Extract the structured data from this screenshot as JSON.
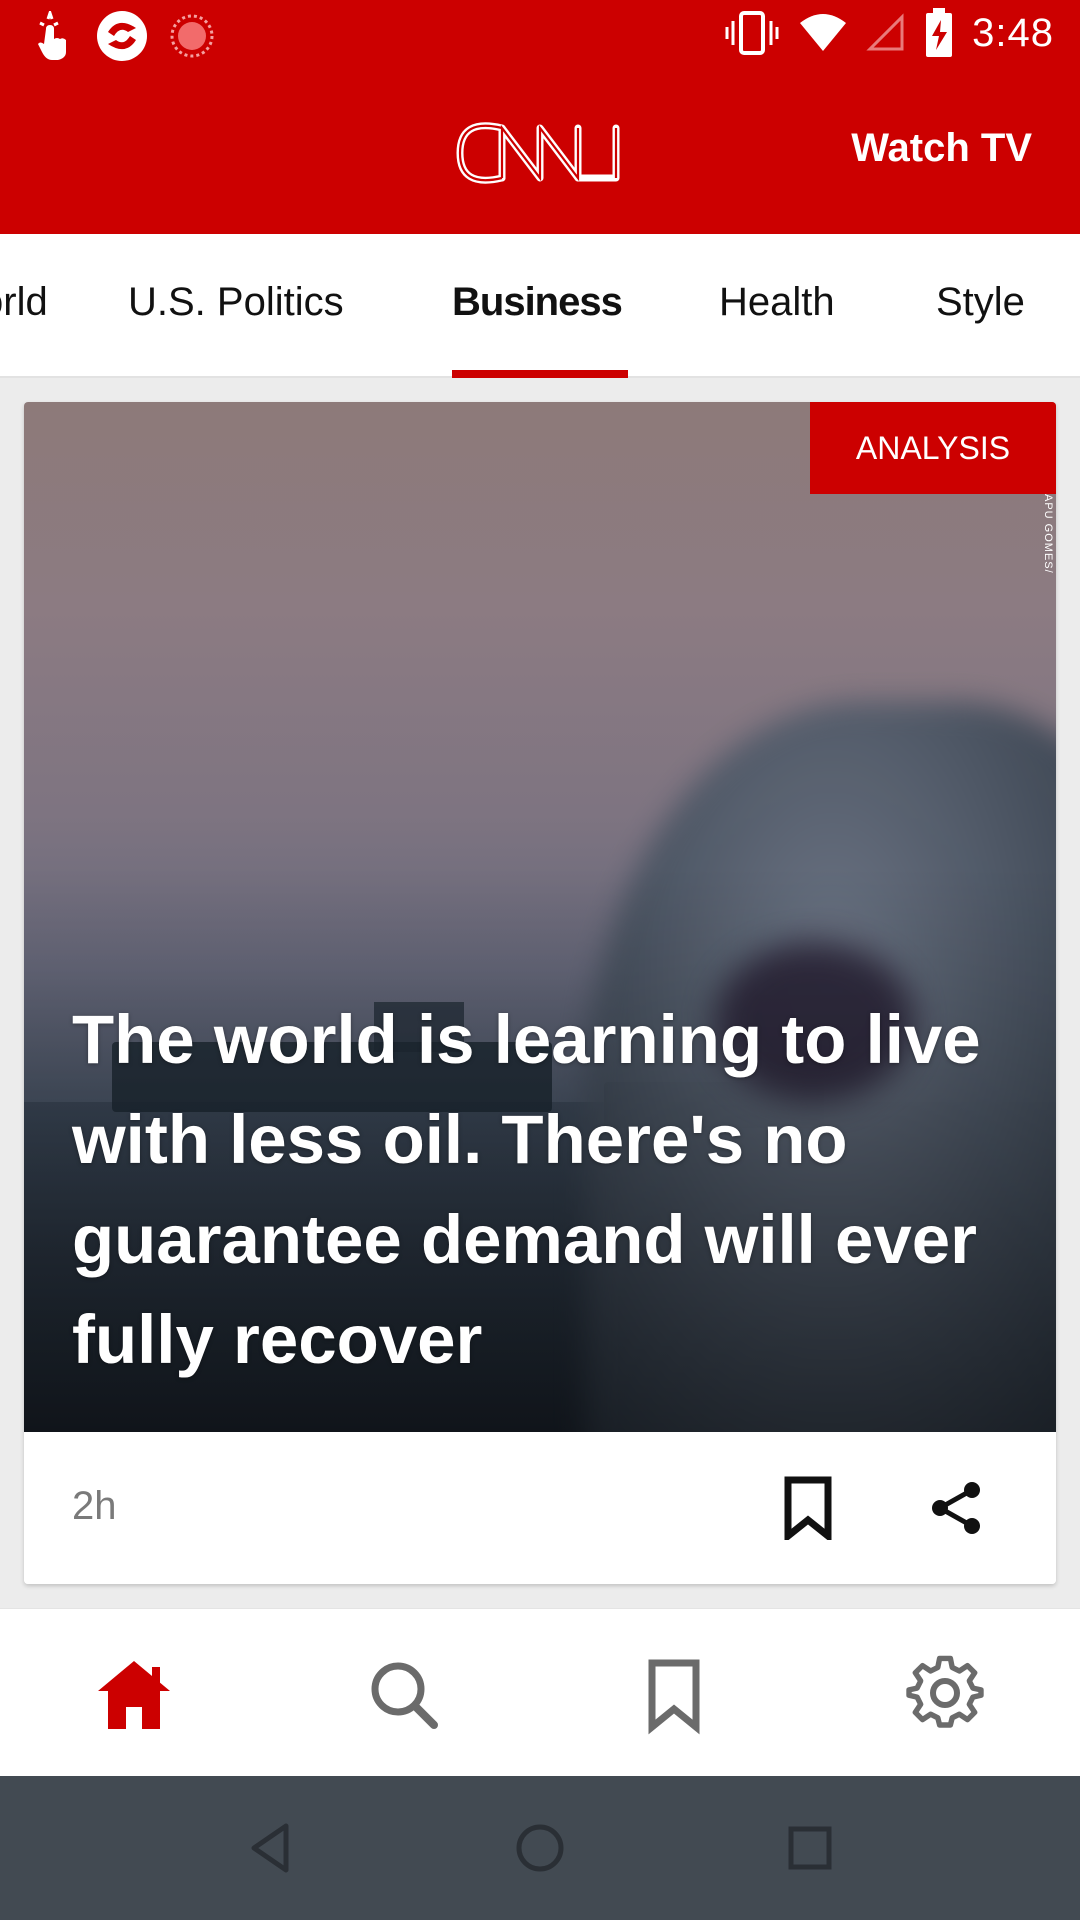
{
  "status_bar": {
    "time": "3:48",
    "left_icons": [
      "touch-icon",
      "app-icon",
      "record-icon"
    ],
    "right_icons": [
      "vibrate-icon",
      "wifi-icon",
      "cell-signal-icon",
      "battery-charging-icon"
    ]
  },
  "header": {
    "logo_text": "CNN",
    "watch_tv_label": "Watch TV"
  },
  "tabs": [
    {
      "label": "World"
    },
    {
      "label": "U.S. Politics"
    },
    {
      "label": "Business"
    },
    {
      "label": "Health"
    },
    {
      "label": "Style"
    }
  ],
  "active_tab": "Business",
  "card": {
    "badge": "ANALYSIS",
    "photo_credit": "APU GOMES/",
    "headline": "The world is learning to live with less oil. There's no guarantee demand will ever fully recover",
    "timestamp": "2h"
  },
  "bottom_nav": [
    {
      "name": "home",
      "icon": "home-icon"
    },
    {
      "name": "search",
      "icon": "search-icon"
    },
    {
      "name": "saved",
      "icon": "bookmark-icon"
    },
    {
      "name": "settings",
      "icon": "gear-icon"
    }
  ],
  "system_nav": [
    "back-icon",
    "home-circle-icon",
    "recents-icon"
  ],
  "colors": {
    "brand_red": "#cc0000",
    "nav_active": "#cc0000",
    "nav_inactive": "#6b6b6b",
    "system_nav_bg": "#424a52"
  }
}
